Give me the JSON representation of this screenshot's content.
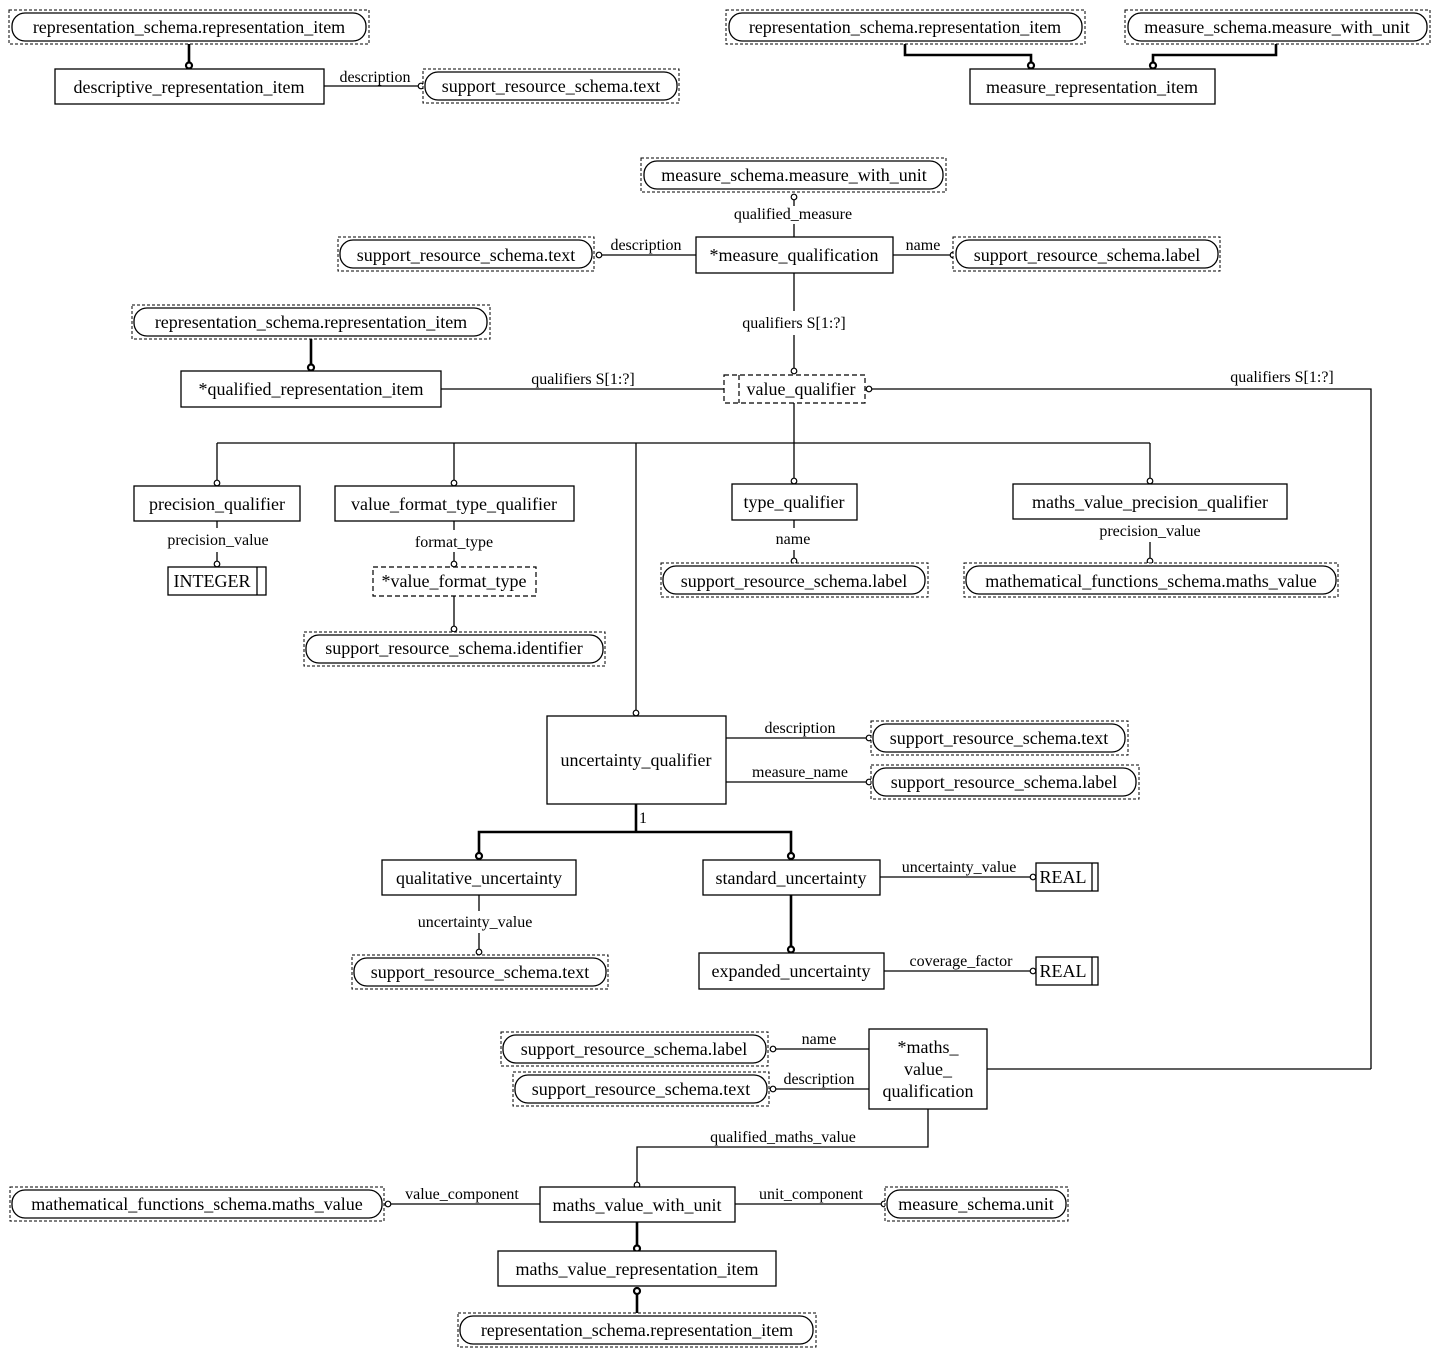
{
  "diagram": {
    "entities": {
      "descriptive_representation_item": "descriptive_representation_item",
      "measure_representation_item": "measure_representation_item",
      "measure_qualification": "*measure_qualification",
      "qualified_representation_item": "*qualified_representation_item",
      "value_qualifier": "value_qualifier",
      "precision_qualifier": "precision_qualifier",
      "value_format_type_qualifier": "value_format_type_qualifier",
      "value_format_type": "*value_format_type",
      "type_qualifier": "type_qualifier",
      "maths_value_precision_qualifier": "maths_value_precision_qualifier",
      "uncertainty_qualifier": "uncertainty_qualifier",
      "qualitative_uncertainty": "qualitative_uncertainty",
      "standard_uncertainty": "standard_uncertainty",
      "expanded_uncertainty": "expanded_uncertainty",
      "maths_value_qualification_1": "*maths_",
      "maths_value_qualification_2": "value_",
      "maths_value_qualification_3": "qualification",
      "maths_value_with_unit": "maths_value_with_unit",
      "maths_value_representation_item": "maths_value_representation_item"
    },
    "external_refs": {
      "rep_item_1": "representation_schema.representation_item",
      "text_1": "support_resource_schema.text",
      "rep_item_2": "representation_schema.representation_item",
      "mwu_1": "measure_schema.measure_with_unit",
      "mwu_2": "measure_schema.measure_with_unit",
      "text_2": "support_resource_schema.text",
      "label_1": "support_resource_schema.label",
      "rep_item_3": "representation_schema.representation_item",
      "identifier_1": "support_resource_schema.identifier",
      "label_2": "support_resource_schema.label",
      "maths_value_1": "mathematical_functions_schema.maths_value",
      "text_3": "support_resource_schema.text",
      "label_3": "support_resource_schema.label",
      "text_4": "support_resource_schema.text",
      "label_4": "support_resource_schema.label",
      "text_5": "support_resource_schema.text",
      "maths_value_2": "mathematical_functions_schema.maths_value",
      "unit_1": "measure_schema.unit",
      "rep_item_4": "representation_schema.representation_item"
    },
    "simple_types": {
      "integer": "INTEGER",
      "real_1": "REAL",
      "real_2": "REAL"
    },
    "relationships": {
      "description_1": "description",
      "qualified_measure": "qualified_measure",
      "description_2": "description",
      "name_1": "name",
      "qualifiers_1": "qualifiers S[1:?]",
      "qualifiers_2": "qualifiers S[1:?]",
      "qualifiers_3": "qualifiers S[1:?]",
      "precision_value_1": "precision_value",
      "format_type": "format_type",
      "name_2": "name",
      "precision_value_2": "precision_value",
      "description_3": "description",
      "measure_name": "measure_name",
      "one_of": "1",
      "uncertainty_value_1": "uncertainty_value",
      "uncertainty_value_2": "uncertainty_value",
      "coverage_factor": "coverage_factor",
      "name_3": "name",
      "description_4": "description",
      "qualified_maths_value": "qualified_maths_value",
      "value_component": "value_component",
      "unit_component": "unit_component"
    }
  }
}
